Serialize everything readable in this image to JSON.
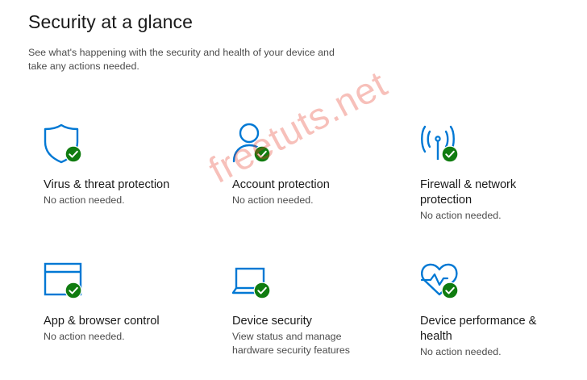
{
  "header": {
    "title": "Security at a glance",
    "description": "See what's happening with the security and health of your device and take any actions needed."
  },
  "tiles": [
    {
      "icon": "shield-icon",
      "title": "Virus & threat protection",
      "status": "No action needed."
    },
    {
      "icon": "person-icon",
      "title": "Account protection",
      "status": "No action needed."
    },
    {
      "icon": "antenna-icon",
      "title": "Firewall & network protection",
      "status": "No action needed."
    },
    {
      "icon": "browser-window-icon",
      "title": "App & browser control",
      "status": "No action needed."
    },
    {
      "icon": "laptop-icon",
      "title": "Device security",
      "status": "View status and manage hardware security features"
    },
    {
      "icon": "heart-pulse-icon",
      "title": "Device performance & health",
      "status": "No action needed."
    }
  ],
  "watermark": "freetuts.net",
  "colors": {
    "icon_blue": "#0078d4",
    "check_green": "#107c10",
    "title_text": "#1a1a1a",
    "secondary_text": "#4c4c4c",
    "watermark": "#e63c28"
  }
}
